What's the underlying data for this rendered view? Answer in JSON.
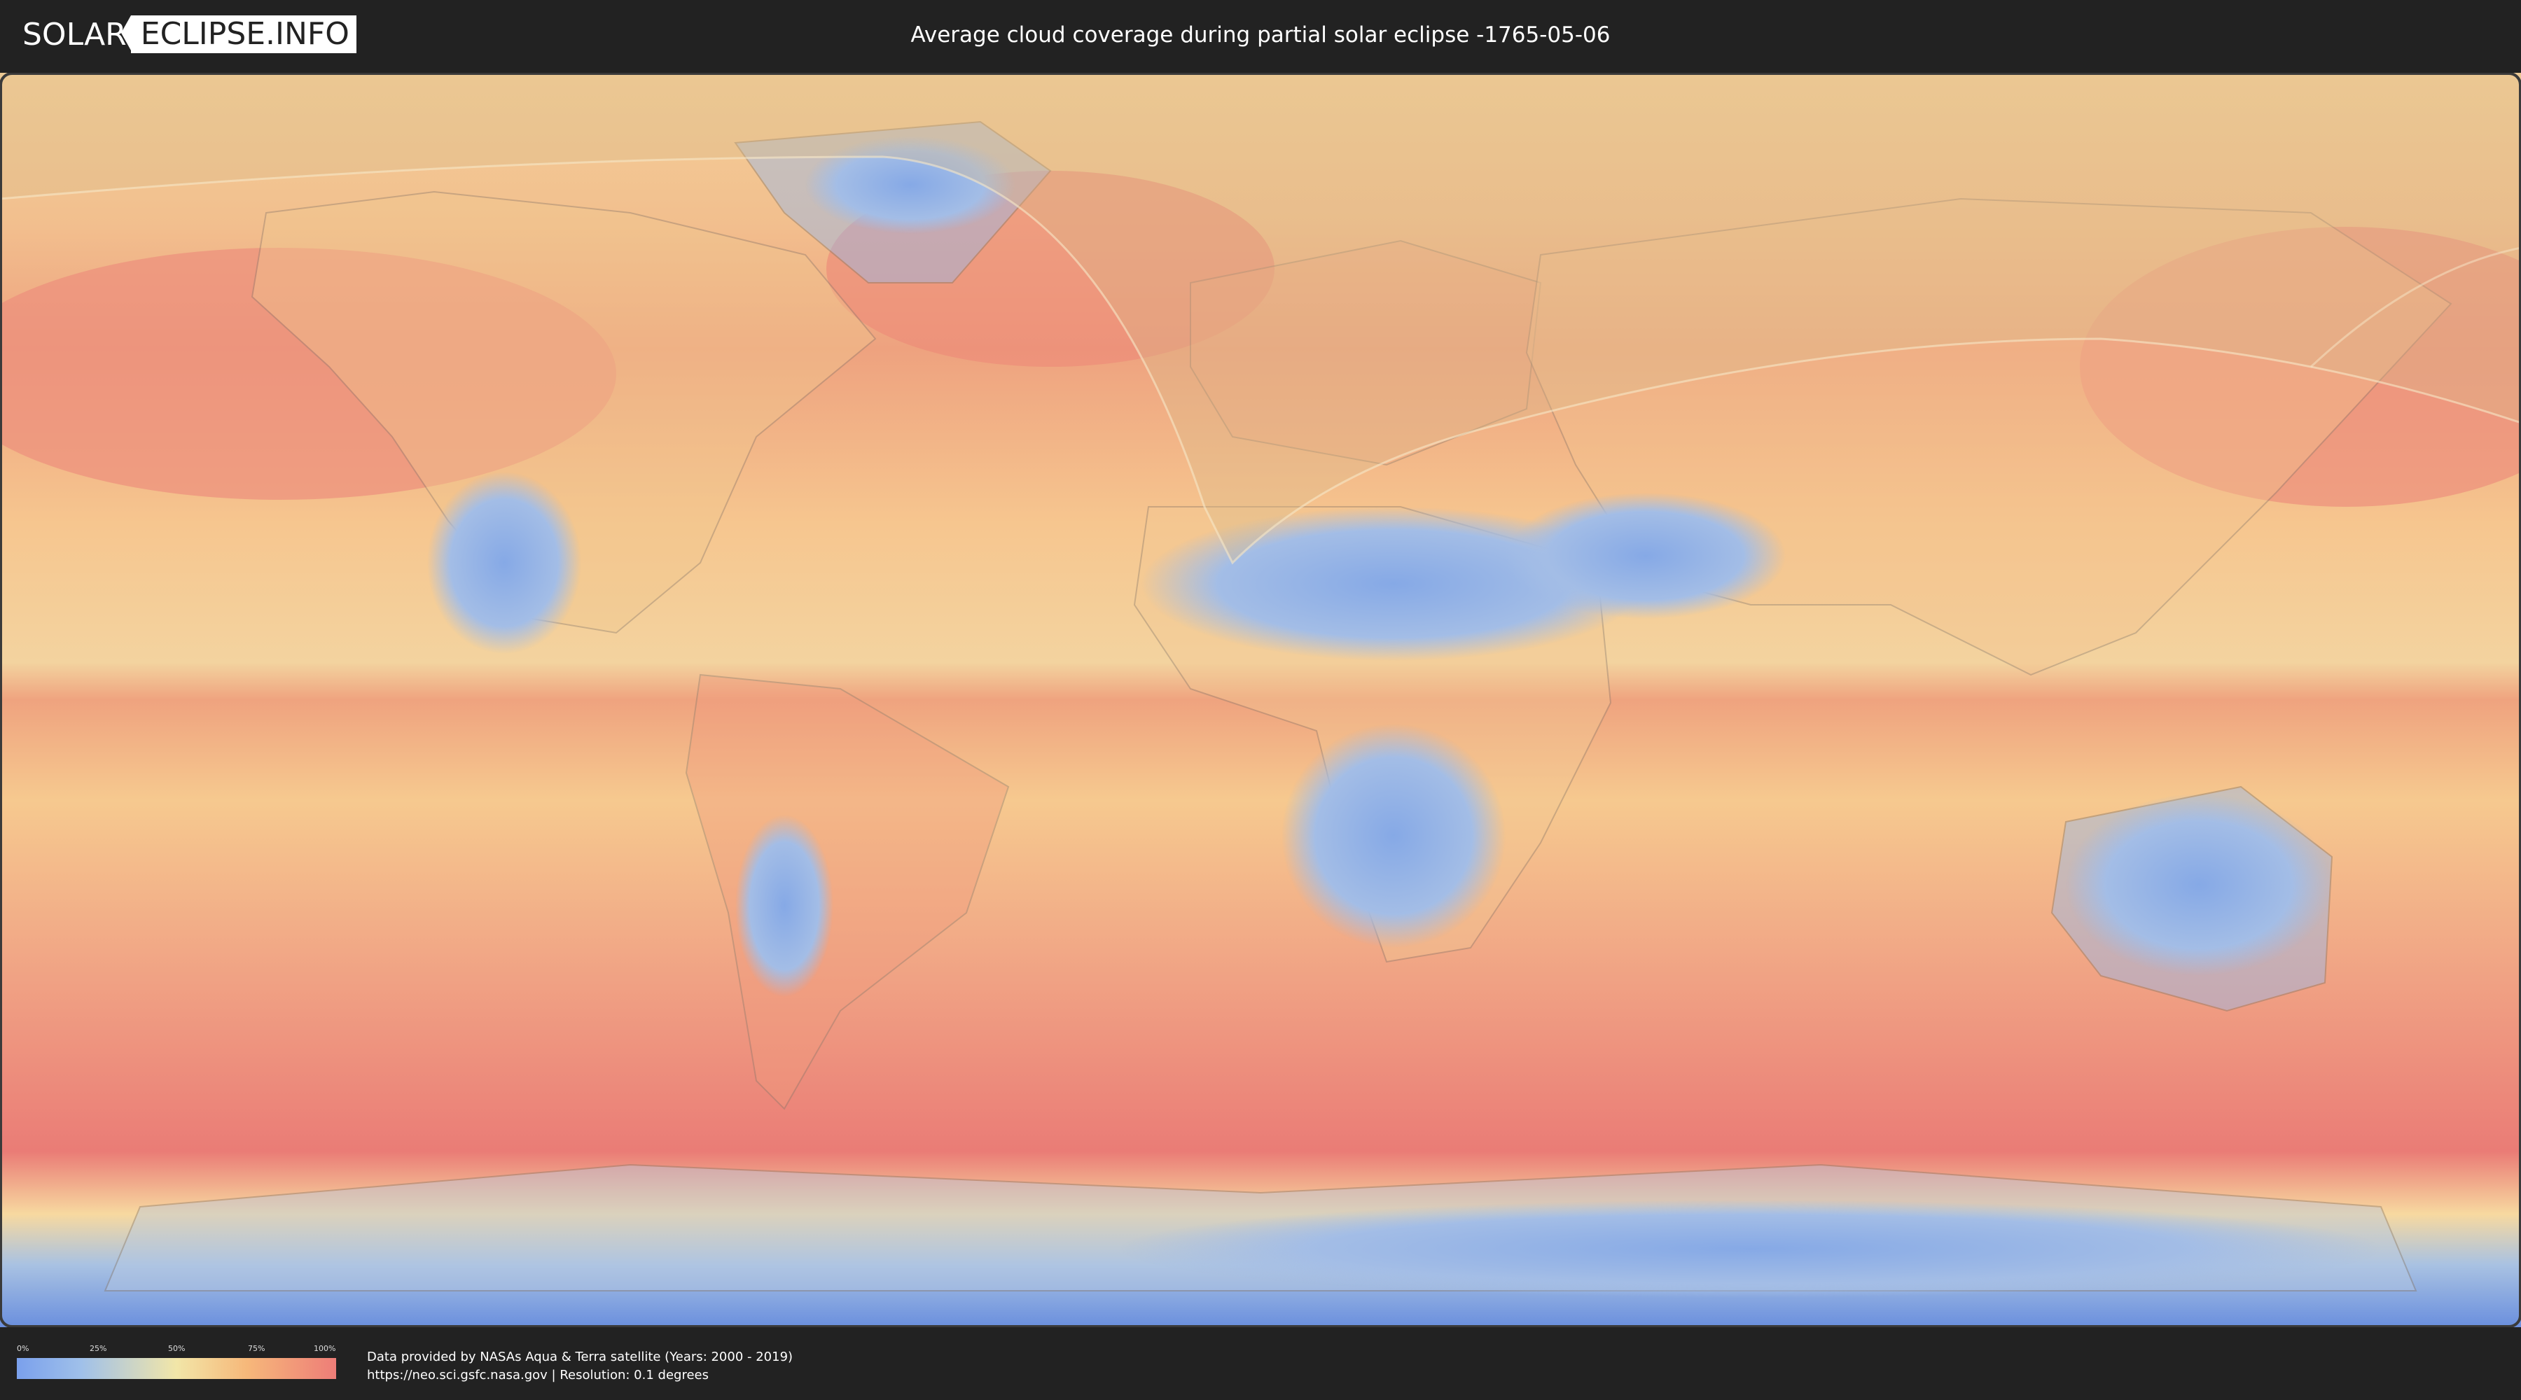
{
  "header": {
    "logo_part1": "SOLAR",
    "logo_part2": "ECLIPSE.INFO",
    "title": "Average cloud coverage during partial solar eclipse -1765-05-06"
  },
  "map": {
    "colors": {
      "ocean_cloudy": "#ee8b7a",
      "mid_cloud": "#f6c88c",
      "low_cloud": "#f3e2a6",
      "clear": "#8fb1e8",
      "very_clear": "#6f93e2",
      "eclipse_shade": "#d8b88a",
      "outline": "#8a7a6a"
    }
  },
  "legend": {
    "ticks": [
      "0%",
      "25%",
      "50%",
      "75%",
      "100%"
    ]
  },
  "source": {
    "line1": "Data provided by NASAs Aqua & Terra satellite (Years: 2000 - 2019)",
    "line2": "https://neo.sci.gsfc.nasa.gov | Resolution: 0.1 degrees"
  }
}
